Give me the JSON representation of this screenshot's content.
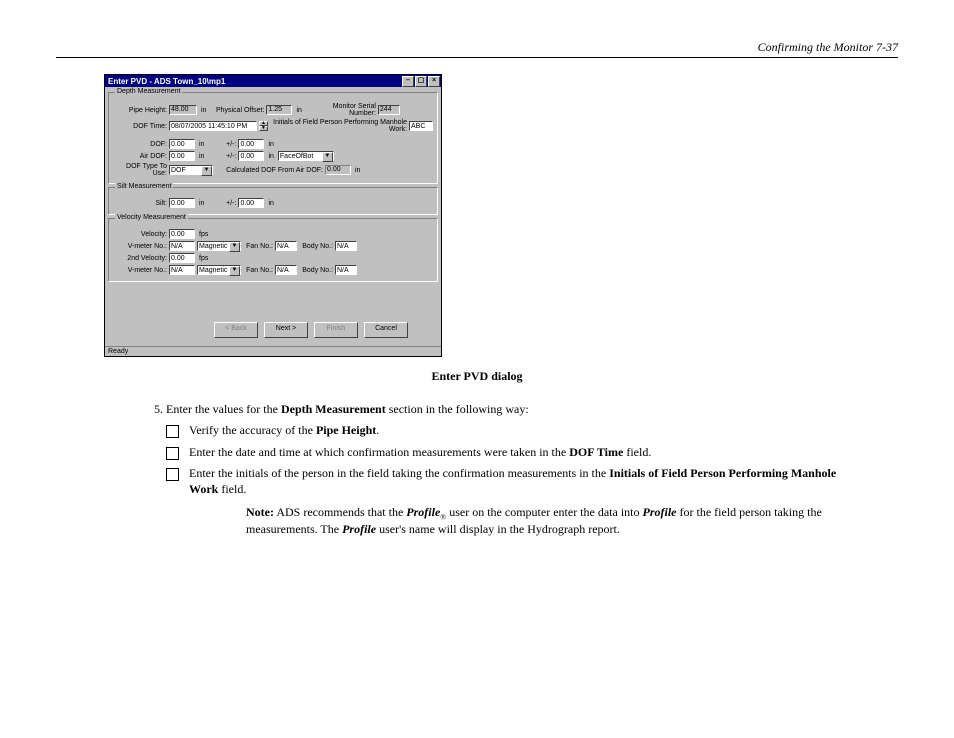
{
  "header": {
    "left": "",
    "right": "Confirming the Monitor   7-37"
  },
  "window": {
    "title": "Enter PVD - ADS Town_10\\mp1",
    "groups": {
      "depth": {
        "legend": "Depth Measurement",
        "pipe_height_label": "Pipe Height:",
        "pipe_height": "48.00",
        "physical_offset_label": "Physical Offset:",
        "physical_offset": "1.25",
        "serial_label": "Monitor Serial Number:",
        "serial": "244",
        "dof_time_label": "DOF Time:",
        "dof_time": "08/07/2005 11:45:10 PM",
        "initials_label": "Initials of Field Person Performing Manhole Work:",
        "initials": "ABC",
        "dof_label": "DOF:",
        "dof": "0.00",
        "dof_pm": "0.00",
        "airdof_label": "Air DOF:",
        "airdof": "0.00",
        "airdof_pm": "0.00",
        "airdof_ref": "FaceOfBot",
        "doftype_label": "DOF Type To Use:",
        "doftype": "DOF",
        "calc_label": "Calculated DOF From Air DOF:",
        "calc": "0.00"
      },
      "silt": {
        "legend": "Silt Measurement",
        "silt_label": "Silt:",
        "silt": "0.00",
        "silt_pm": "0.00"
      },
      "vel": {
        "legend": "Velocity Measurement",
        "velocity_label": "Velocity:",
        "velocity": "0.00",
        "vmeter_label": "V-meter No.:",
        "vmeter1": "N/A",
        "vmeter1_type": "Magnetic",
        "fan_label": "Fan No.:",
        "fan1": "N/A",
        "body_label": "Body No.:",
        "body1": "N/A",
        "velocity2_label": "2nd Velocity:",
        "velocity2": "0.00",
        "vmeter2": "N/A",
        "vmeter2_type": "Magnetic",
        "fan2": "N/A",
        "body2": "N/A",
        "unit_fps": "fps"
      }
    },
    "buttons": {
      "back": "< Back",
      "next": "Next >",
      "finish": "Finish",
      "cancel": "Cancel"
    },
    "status": "Ready",
    "unit_in": "in",
    "plus_minus": "+/-:"
  },
  "caption": "Enter PVD dialog",
  "steps": {
    "n5": {
      "intro_1": "Enter the values for the ",
      "intro_b": "Depth Measurement",
      "intro_2": " section in the following way:",
      "cb1_1": "Verify the accuracy of the ",
      "cb1_b": "Pipe Height",
      "cb1_2": ".",
      "cb2_1": "Enter the date and time at which confirmation measurements were taken in the ",
      "cb2_b": "DOF Time",
      "cb2_2": " field.",
      "cb3_1": "Enter the initials of the person in the field taking the confirmation measurements in the ",
      "cb3_b": "Initials of Field Person Performing Manhole Work",
      "cb3_2": " field.",
      "note_b": "Note:",
      "note_1": " ADS recommends that the ",
      "note_i": "Profile",
      "note_2": " user on the computer enter the data into ",
      "note_i2": "Profile",
      "note_3": " for the field person taking the measurements.  The ",
      "note_i3": "Profile",
      "note_4": " user's name will display in the Hydrograph report."
    }
  },
  "glyph": {
    "up": "▲",
    "down": "▼",
    "close": "×",
    "min": "–"
  }
}
